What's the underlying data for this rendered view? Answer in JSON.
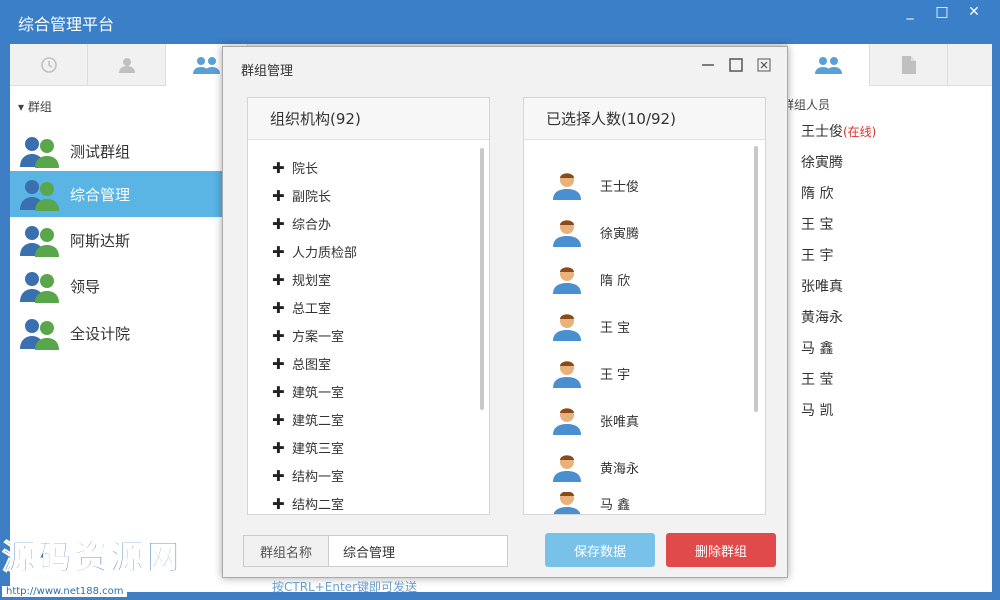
{
  "window": {
    "title": "综合管理平台",
    "controls": [
      "_",
      "□",
      "✕"
    ]
  },
  "tabs": [
    {
      "icon": "clock-icon"
    },
    {
      "icon": "user-icon"
    },
    {
      "icon": "group-icon",
      "active": true
    },
    {
      "icon": "group-icon"
    },
    {
      "icon": "document-icon"
    }
  ],
  "groups": {
    "header": "群组",
    "items": [
      {
        "label": "测试群组",
        "active": false
      },
      {
        "label": "综合管理",
        "active": true
      },
      {
        "label": "阿斯达斯",
        "active": false
      },
      {
        "label": "领导",
        "active": false
      },
      {
        "label": "全设计院",
        "active": false
      }
    ]
  },
  "members": {
    "header": "群组人员",
    "items": [
      {
        "name": "王士俊",
        "status": "(在线)"
      },
      {
        "name": "徐寅腾"
      },
      {
        "name": "隋 欣"
      },
      {
        "name": "王 宝"
      },
      {
        "name": "王 宇"
      },
      {
        "name": "张唯真"
      },
      {
        "name": "黄海永"
      },
      {
        "name": "马 鑫"
      },
      {
        "name": "王 莹"
      },
      {
        "name": "马 凯"
      }
    ]
  },
  "dialog": {
    "title": "群组管理",
    "org_header": "组织机构(92)",
    "org_items": [
      "院长",
      "副院长",
      "综合办",
      "人力质检部",
      "规划室",
      "总工室",
      "方案一室",
      "总图室",
      "建筑一室",
      "建筑二室",
      "建筑三室",
      "结构一室",
      "结构二室"
    ],
    "selected_header": "已选择人数(10/92)",
    "selected_items": [
      "王士俊",
      "徐寅腾",
      "隋 欣",
      "王 宝",
      "王 宇",
      "张唯真",
      "黄海永",
      "马 鑫"
    ],
    "name_label": "群组名称",
    "name_value": "综合管理",
    "save_label": "保存数据",
    "delete_label": "删除群组"
  },
  "hint": "按CTRL+Enter键即可发送",
  "watermark": {
    "text": "源码资源网",
    "url": "http://www.net188.com"
  },
  "colors": {
    "titlebar": "#3a7fc7",
    "active_group": "#5ab4e4",
    "save": "#78c2ea",
    "delete": "#e04a4a",
    "online": "#d9342b"
  }
}
